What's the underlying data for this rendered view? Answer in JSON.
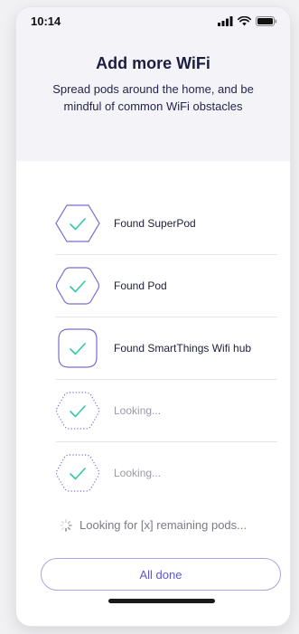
{
  "status_bar": {
    "time": "10:14"
  },
  "header": {
    "title": "Add more WiFi",
    "subtitle": "Spread pods around the home, and be mindful of common WiFi obstacles"
  },
  "pods": [
    {
      "label": "Found SuperPod",
      "state": "found",
      "icon": "hexagon-check-icon"
    },
    {
      "label": "Found Pod",
      "state": "found",
      "icon": "rounded-hexagon-check-icon"
    },
    {
      "label": "Found SmartThings Wifi hub",
      "state": "found",
      "icon": "rounded-square-check-icon"
    },
    {
      "label": "Looking...",
      "state": "searching",
      "icon": "dotted-hexagon-check-icon"
    },
    {
      "label": "Looking...",
      "state": "searching",
      "icon": "dotted-hexagon-check-icon"
    }
  ],
  "searching_text": "Looking for [x] remaining pods...",
  "done_button": {
    "label": "All done"
  },
  "colors": {
    "accent": "#5a57d6",
    "outline": "#7b6ad6",
    "check": "#33c9a4",
    "header_bg": "#f4f4f8"
  }
}
